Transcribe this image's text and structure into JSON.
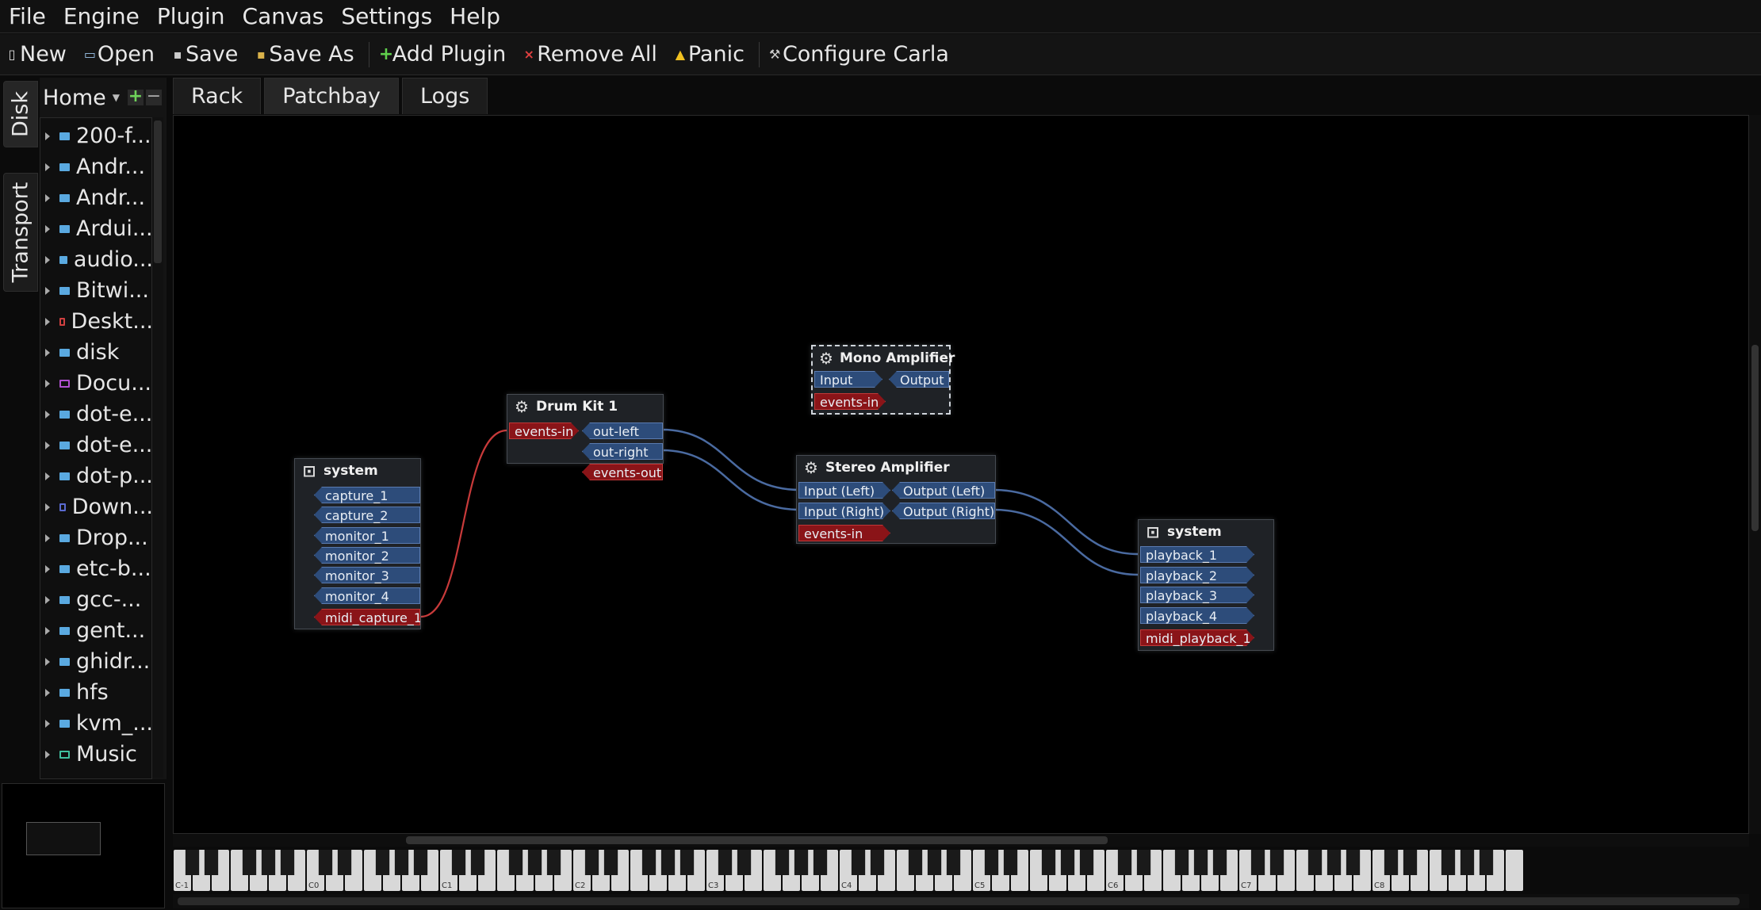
{
  "menubar": {
    "items": [
      "File",
      "Engine",
      "Plugin",
      "Canvas",
      "Settings",
      "Help"
    ]
  },
  "toolbar": {
    "new": "New",
    "open": "Open",
    "save": "Save",
    "save_as": "Save As",
    "add_plugin": "Add Plugin",
    "remove_all": "Remove All",
    "panic": "Panic",
    "configure": "Configure Carla"
  },
  "side_tabs": {
    "disk": "Disk",
    "transport": "Transport"
  },
  "file_panel": {
    "home": "Home",
    "items": [
      "200-f...",
      "Andr...",
      "Andr...",
      "Ardui...",
      "audio...",
      "Bitwi...",
      "Deskt...",
      "disk",
      "Docu...",
      "dot-e...",
      "dot-e...",
      "dot-p...",
      "Down...",
      "Drop...",
      "etc-b...",
      "gcc-...",
      "gent...",
      "ghidr...",
      "hfs",
      "kvm_...",
      "Music"
    ]
  },
  "tabs": [
    "Rack",
    "Patchbay",
    "Logs"
  ],
  "active_tab": "Patchbay",
  "colors": {
    "audio_port": "#2d4c7a",
    "midi_port": "#8a1418",
    "audio_wire": "#4a6aa0",
    "midi_wire": "#c83a3a"
  },
  "patchbay": {
    "system_in": {
      "title": "system",
      "ports": [
        "capture_1",
        "capture_2",
        "monitor_1",
        "monitor_2",
        "monitor_3",
        "monitor_4",
        "midi_capture_1"
      ]
    },
    "drum_kit": {
      "title": "Drum Kit 1",
      "ports": [
        "events-in",
        "out-left",
        "out-right",
        "events-out"
      ]
    },
    "mono_amp": {
      "title": "Mono Amplifier",
      "ports": [
        "Input",
        "Output",
        "events-in"
      ]
    },
    "stereo_amp": {
      "title": "Stereo Amplifier",
      "ports": [
        "Input (Left)",
        "Output (Left)",
        "Input (Right)",
        "Output (Right)",
        "events-in"
      ]
    },
    "system_out": {
      "title": "system",
      "ports": [
        "playback_1",
        "playback_2",
        "playback_3",
        "playback_4",
        "midi_playback_1"
      ]
    }
  },
  "keyboard": {
    "octave_labels": [
      "C-1",
      "C0",
      "C1",
      "C2",
      "C3",
      "C4",
      "C5",
      "C6",
      "C7",
      "C8"
    ]
  }
}
